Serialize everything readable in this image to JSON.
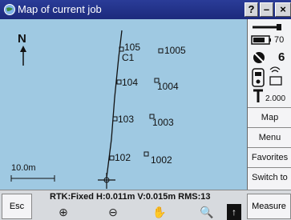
{
  "window": {
    "title": "Map of current job",
    "help_label": "?",
    "minimize_label": "–",
    "close_label": "×",
    "icon": "map-globe-icon"
  },
  "map": {
    "north_label": "N",
    "scale_label": "10.0m",
    "points": [
      {
        "id": "105",
        "label": "105"
      },
      {
        "id": "C1",
        "label": "C1"
      },
      {
        "id": "1005",
        "label": "1005"
      },
      {
        "id": "104",
        "label": "104"
      },
      {
        "id": "1004",
        "label": "1004"
      },
      {
        "id": "103",
        "label": "103"
      },
      {
        "id": "1003",
        "label": "1003"
      },
      {
        "id": "102",
        "label": "102"
      },
      {
        "id": "1002",
        "label": "1002"
      }
    ]
  },
  "status": {
    "battery_text": "70",
    "satellites_text": "6",
    "height_text": "2.000",
    "icons": [
      "radio-icon",
      "battery-icon",
      "satellite-icon",
      "receiver-icon",
      "pole-icon"
    ]
  },
  "side_buttons": {
    "map": "Map",
    "menu": "Menu",
    "favorites": "Favorites",
    "switch": "Switch to"
  },
  "bottom": {
    "esc_label": "Esc",
    "status_text": "RTK:Fixed H:0.011m V:0.015m RMS:13",
    "measure_label": "Measure",
    "tools": [
      {
        "name": "zoom-in-icon",
        "glyph": "⊕"
      },
      {
        "name": "zoom-out-icon",
        "glyph": "⊖"
      },
      {
        "name": "pan-hand-icon",
        "glyph": "✋"
      },
      {
        "name": "zoom-extents-icon",
        "glyph": "🔍"
      }
    ],
    "arrow_glyph": "↑"
  }
}
